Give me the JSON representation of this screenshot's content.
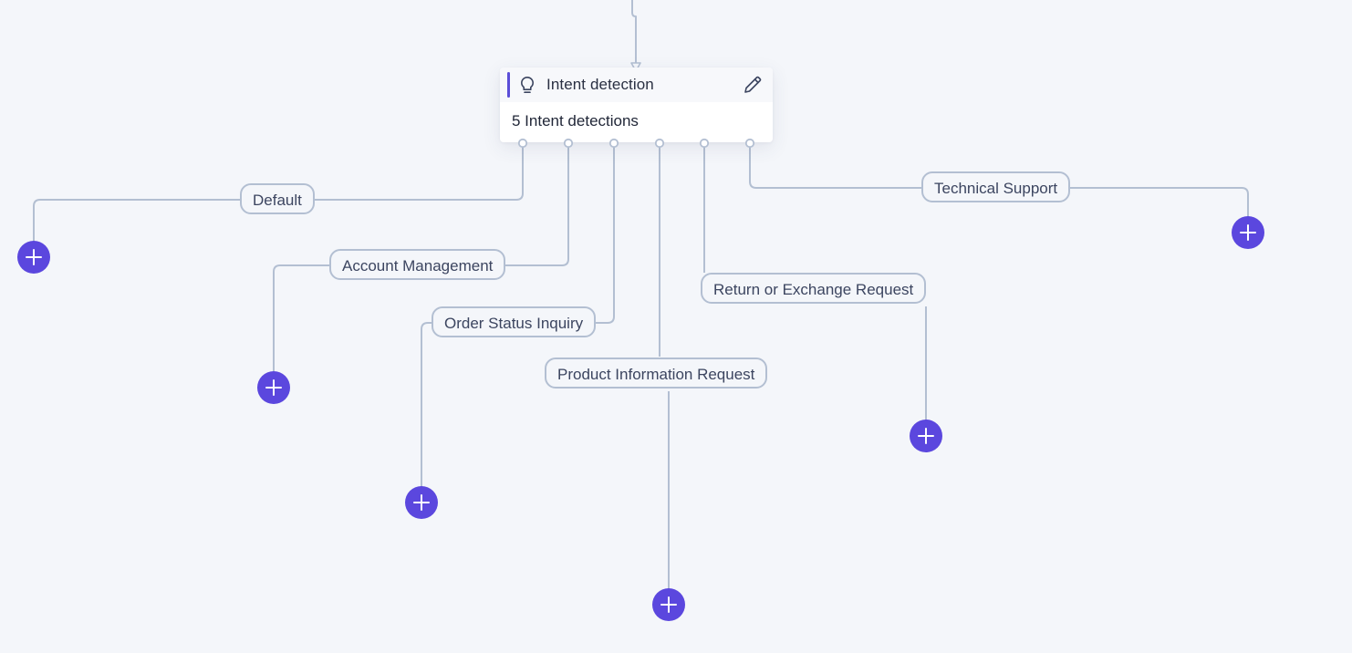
{
  "node": {
    "title": "Intent detection",
    "subtitle": "5 Intent detections",
    "icon": "lightbulb-icon",
    "edit_icon": "pencil-icon",
    "accent_color": "#5b4ed8"
  },
  "branches": [
    {
      "label": "Default"
    },
    {
      "label": "Account Management"
    },
    {
      "label": "Order Status Inquiry"
    },
    {
      "label": "Product Information Request"
    },
    {
      "label": "Return or Exchange Request"
    },
    {
      "label": "Technical Support"
    }
  ],
  "add_button": {
    "icon": "plus-icon",
    "color": "#5b47de"
  },
  "connector_color": "#b3bfd2"
}
